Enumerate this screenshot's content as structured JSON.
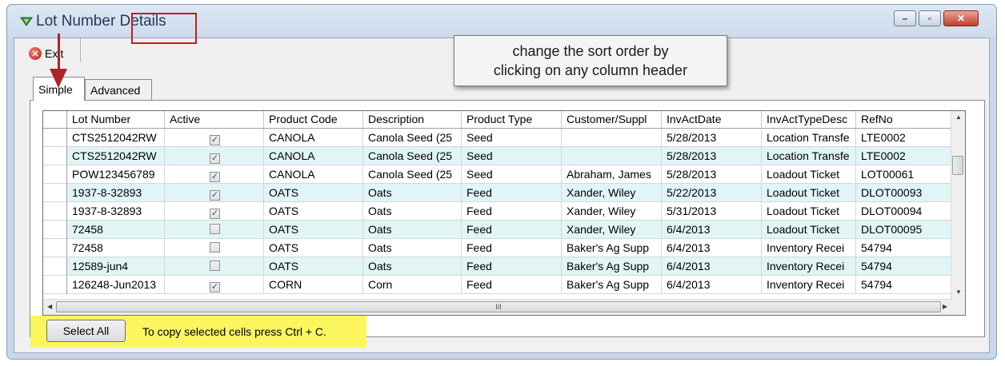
{
  "window": {
    "title_part1": "Lot Number ",
    "title_part2": "Details",
    "controls": {
      "minimize": "–",
      "maximize": "▫",
      "close": "✕"
    }
  },
  "toolbar": {
    "exit_label": "Exit"
  },
  "callout": {
    "line1": "change the sort order by",
    "line2": "clicking on any column header"
  },
  "tabs": [
    {
      "label": "Simple",
      "active": true
    },
    {
      "label": "Advanced",
      "active": false
    }
  ],
  "grid": {
    "columns": [
      "Lot Number",
      "Active",
      "Product Code",
      "Description",
      "Product Type",
      "Customer/Suppl",
      "InvActDate",
      "InvActTypeDesc",
      "RefNo"
    ],
    "rows": [
      [
        "CTS2512042RW",
        true,
        "CANOLA",
        "Canola Seed (25",
        "Seed",
        "",
        "5/28/2013",
        "Location Transfe",
        "LTE0002"
      ],
      [
        "CTS2512042RW",
        true,
        "CANOLA",
        "Canola Seed (25",
        "Seed",
        "",
        "5/28/2013",
        "Location Transfe",
        "LTE0002"
      ],
      [
        "POW123456789",
        true,
        "CANOLA",
        "Canola Seed (25",
        "Seed",
        "Abraham, James",
        "5/28/2013",
        "Loadout Ticket",
        "LOT00061"
      ],
      [
        "1937-8-32893",
        true,
        "OATS",
        "Oats",
        "Feed",
        "Xander, Wiley",
        "5/22/2013",
        "Loadout Ticket",
        "DLOT00093"
      ],
      [
        "1937-8-32893",
        true,
        "OATS",
        "Oats",
        "Feed",
        "Xander, Wiley",
        "5/31/2013",
        "Loadout Ticket",
        "DLOT00094"
      ],
      [
        "72458",
        false,
        "OATS",
        "Oats",
        "Feed",
        "Xander, Wiley",
        "6/4/2013",
        "Loadout Ticket",
        "DLOT00095"
      ],
      [
        "72458",
        false,
        "OATS",
        "Oats",
        "Feed",
        "Baker's Ag Supp",
        "6/4/2013",
        "Inventory Recei",
        "54794"
      ],
      [
        "12589-jun4",
        false,
        "OATS",
        "Oats",
        "Feed",
        "Baker's Ag Supp",
        "6/4/2013",
        "Inventory Recei",
        "54794"
      ],
      [
        "126248-Jun2013",
        true,
        "CORN",
        "Corn",
        "Feed",
        "Baker's Ag Supp",
        "6/4/2013",
        "Inventory Recei",
        "54794"
      ]
    ],
    "hscroll_grip": "III"
  },
  "footer": {
    "select_all": "Select All",
    "hint": "To copy selected cells press Ctrl + C."
  },
  "colors": {
    "alt_row": "#e1f5f7",
    "highlight": "#fbf65e",
    "annotation_red": "#c41b23"
  }
}
